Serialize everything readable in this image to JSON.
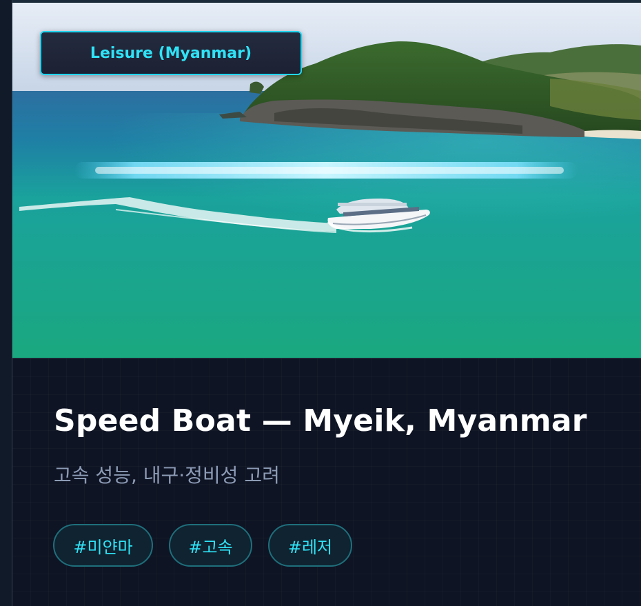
{
  "card": {
    "category_badge": "Leisure (Myanmar)",
    "title": "Speed Boat — Myeik, Myanmar",
    "subtitle": "고속 성능, 내구·정비성 고려",
    "tags": [
      "#미얀마",
      "#고속",
      "#레저"
    ],
    "image_alt": "Speed boat on turquoise water near a forested island"
  },
  "colors": {
    "accent": "#22d6f0",
    "background": "#0f1424",
    "title": "#ffffff",
    "subtitle": "#8c9bb5",
    "water": "#1fae8f"
  }
}
